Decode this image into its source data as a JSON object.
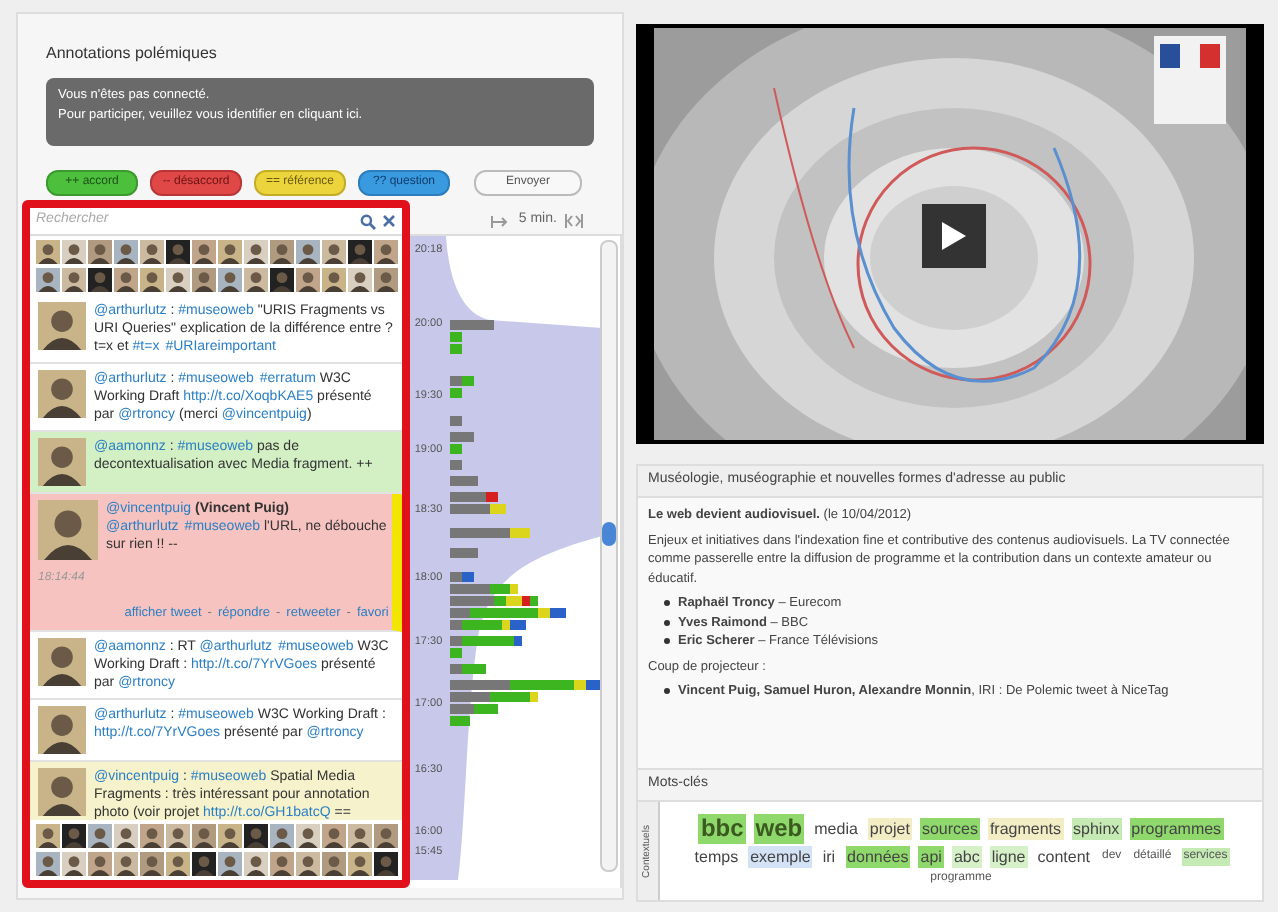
{
  "annotations": {
    "title": "Annotations polémiques",
    "notice": [
      "Vous n'êtes pas connecté.",
      "Pour participer, veuillez vous identifier en cliquant ici."
    ],
    "buttons": [
      {
        "kind": "accord",
        "label": "++ accord"
      },
      {
        "kind": "desaccord",
        "label": "-- désaccord"
      },
      {
        "kind": "reference",
        "label": "== référence"
      },
      {
        "kind": "question",
        "label": "?? question"
      },
      {
        "kind": "send",
        "label": "Envoyer"
      }
    ]
  },
  "search": {
    "placeholder": "Rechercher"
  },
  "tweets": [
    {
      "color": "#ffffff",
      "expanded": false,
      "segments": [
        {
          "text": "@arthurlutz",
          "link": true
        },
        {
          "text": " : ",
          "link": false
        },
        {
          "text": "#museoweb",
          "link": true
        },
        {
          "text": " \"URIS Fragments vs URI Queries\" explication de la différence entre ?t=x et ",
          "link": false
        },
        {
          "text": "#t=x",
          "link": true
        },
        {
          "text": "#URIareimportant",
          "link": true
        }
      ]
    },
    {
      "color": "#ffffff",
      "expanded": false,
      "segments": [
        {
          "text": "@arthurlutz",
          "link": true
        },
        {
          "text": " : ",
          "link": false
        },
        {
          "text": "#museoweb",
          "link": true
        },
        {
          "text": "#erratum",
          "link": true
        },
        {
          "text": " W3C Working Draft ",
          "link": false
        },
        {
          "text": "http://t.co/XoqbKAE5",
          "link": true
        },
        {
          "text": " présenté par ",
          "link": false
        },
        {
          "text": "@rtroncy",
          "link": true
        },
        {
          "text": " (merci ",
          "link": false
        },
        {
          "text": "@vincentpuig",
          "link": true
        },
        {
          "text": ")",
          "link": false
        }
      ]
    },
    {
      "color": "#d3efc4",
      "expanded": false,
      "segments": [
        {
          "text": "@aamonnz",
          "link": true
        },
        {
          "text": " : ",
          "link": false
        },
        {
          "text": "#museoweb",
          "link": true
        },
        {
          "text": " pas de decontextualisation avec Media fragment. ++",
          "link": false
        }
      ]
    },
    {
      "color": "#f7c3c0",
      "expanded": true,
      "author": {
        "handle": "@vincentpuig",
        "name": "(Vincent Puig)"
      },
      "time": "18:14:44",
      "actions": [
        "afficher tweet",
        "-",
        "répondre",
        "-",
        "retweeter",
        "-",
        "favori"
      ],
      "segments": [
        {
          "text": "@arthurlutz",
          "link": true
        },
        {
          "text": "#museoweb",
          "link": true
        },
        {
          "text": " l'URL, ne débouche sur rien !! --",
          "link": false
        }
      ]
    },
    {
      "color": "#ffffff",
      "expanded": false,
      "segments": [
        {
          "text": "@aamonnz",
          "link": true
        },
        {
          "text": " : RT ",
          "link": false
        },
        {
          "text": "@arthurlutz",
          "link": true
        },
        {
          "text": "#museoweb",
          "link": true
        },
        {
          "text": " W3C Working Draft : ",
          "link": false
        },
        {
          "text": "http://t.co/7YrVGoes",
          "link": true
        },
        {
          "text": " présenté par ",
          "link": false
        },
        {
          "text": "@rtroncy",
          "link": true
        }
      ]
    },
    {
      "color": "#ffffff",
      "expanded": false,
      "segments": [
        {
          "text": "@arthurlutz",
          "link": true
        },
        {
          "text": " : ",
          "link": false
        },
        {
          "text": "#museoweb",
          "link": true
        },
        {
          "text": " W3C Working Draft : ",
          "link": false
        },
        {
          "text": "http://t.co/7YrVGoes",
          "link": true
        },
        {
          "text": " présenté par ",
          "link": false
        },
        {
          "text": "@rtroncy",
          "link": true
        }
      ]
    },
    {
      "color": "#f6f2cc",
      "expanded": false,
      "segments": [
        {
          "text": "@vincentpuig",
          "link": true
        },
        {
          "text": " : ",
          "link": false
        },
        {
          "text": "#museoweb",
          "link": true
        },
        {
          "text": " Spatial Media Fragments : très intéressant pour annotation photo (voir projet ",
          "link": false
        },
        {
          "text": "http://t.co/GH1batcQ",
          "link": true
        },
        {
          "text": " ==",
          "link": false
        }
      ]
    }
  ],
  "timeline": {
    "scale": "5 min.",
    "times": [
      "20:18",
      "20:00",
      "19:30",
      "19:00",
      "18:30",
      "18:00",
      "17:30",
      "17:00",
      "16:30",
      "16:00",
      "15:45"
    ]
  },
  "info": {
    "title": "Muséologie, muséographie et nouvelles formes d'adresse au public",
    "headline": "**Le web devient audiovisuel.** (le 10/04/2012)",
    "description": "Enjeux et initiatives dans l'indexation fine et contributive des contenus audiovisuels. La TV connectée comme passerelle entre la diffusion de programme et la contribution dans un contexte amateur ou éducatif.",
    "speakers": [
      "**Raphaël Troncy** – Eurecom",
      "**Yves Raimond** – BBC",
      "**Eric Scherer** – France Télévisions"
    ],
    "spotlight_label": "Coup de projecteur :",
    "spotlight": [
      "**Vincent Puig, Samuel Huron, Alexandre Monnin**, IRI : De Polemic tweet à NiceTag"
    ]
  },
  "keywords": {
    "title": "Mots-clés",
    "tab": "Contextuels",
    "tags": [
      {
        "text": "bbc",
        "kind": "large",
        "color": "#8fd86c"
      },
      {
        "text": "web",
        "kind": "large",
        "color": "#8fd86c"
      },
      {
        "text": "media",
        "kind": "medium"
      },
      {
        "text": "projet",
        "kind": "medium",
        "color": "#f3edc6"
      },
      {
        "text": "sources",
        "kind": "medium",
        "color": "#8fd86c"
      },
      {
        "text": "fragments",
        "kind": "medium",
        "color": "#f3edc6"
      },
      {
        "text": "sphinx",
        "kind": "medium",
        "color": "#c6eab4"
      },
      {
        "text": "programmes",
        "kind": "medium",
        "color": "#8fd86c"
      },
      {
        "text": "temps",
        "kind": "medium"
      },
      {
        "text": "exemple",
        "kind": "medium",
        "color": "#d4e2f6"
      },
      {
        "text": "iri",
        "kind": "medium"
      },
      {
        "text": "données",
        "kind": "medium",
        "color": "#8fd86c"
      },
      {
        "text": "api",
        "kind": "medium",
        "color": "#8fd86c"
      },
      {
        "text": "abc",
        "kind": "medium",
        "color": "#d6f0c8"
      },
      {
        "text": "ligne",
        "kind": "medium",
        "color": "#d6f0c8"
      },
      {
        "text": "content",
        "kind": "medium"
      },
      {
        "text": "dev",
        "kind": "small"
      },
      {
        "text": "détaillé",
        "kind": "small"
      },
      {
        "text": "services",
        "kind": "small",
        "color": "#c6eab4"
      },
      {
        "text": "programme",
        "kind": "small"
      }
    ]
  }
}
